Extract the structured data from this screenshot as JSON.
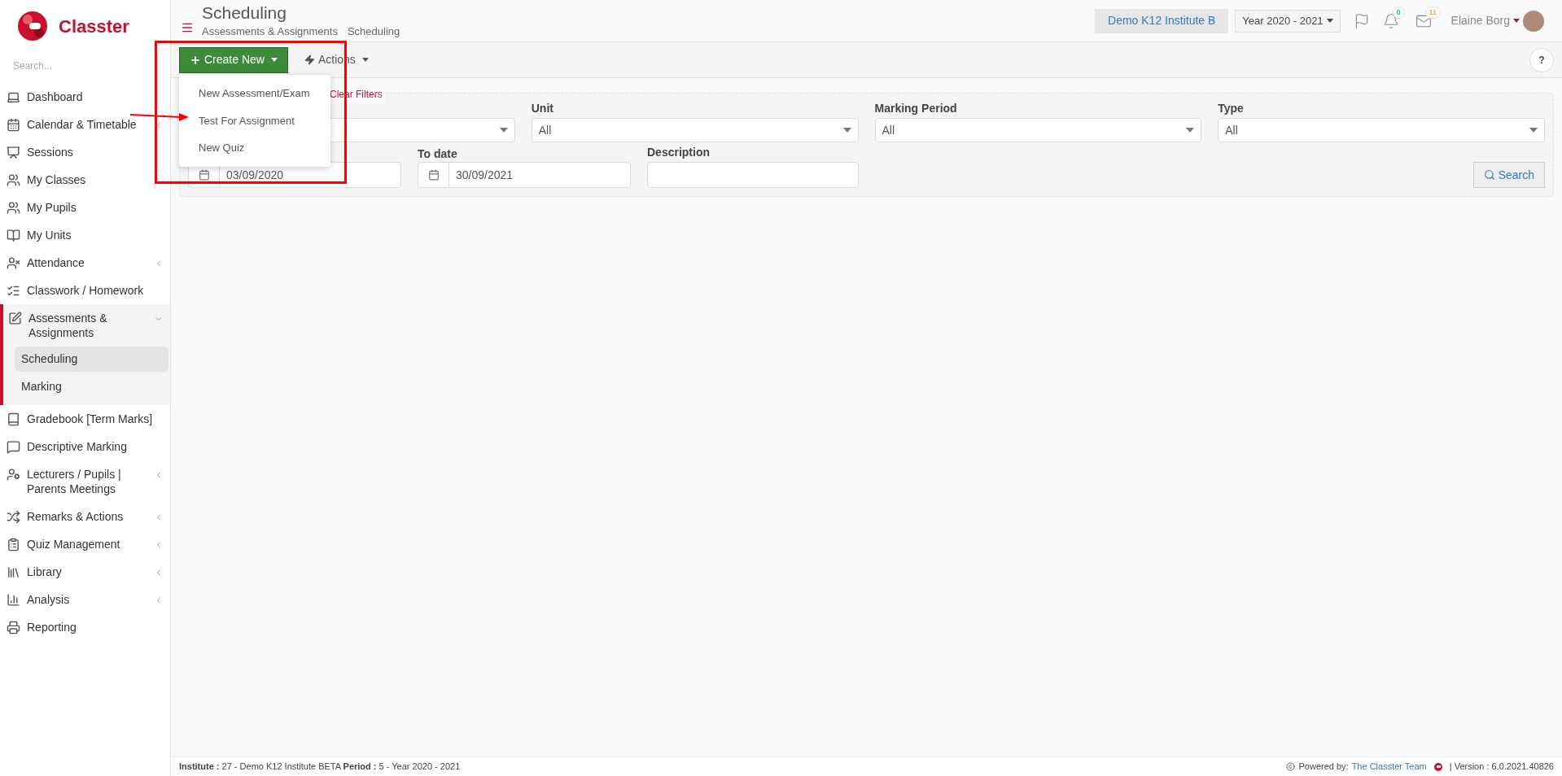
{
  "sidebar": {
    "logo_text": "Classter",
    "search_placeholder": "Search...",
    "items": [
      {
        "label": "Dashboard",
        "expandable": false,
        "selected": false
      },
      {
        "label": "Calendar & Timetable",
        "expandable": true,
        "selected": false
      },
      {
        "label": "Sessions",
        "expandable": false,
        "selected": false
      },
      {
        "label": "My Classes",
        "expandable": false,
        "selected": false
      },
      {
        "label": "My Pupils",
        "expandable": false,
        "selected": false
      },
      {
        "label": "My Units",
        "expandable": false,
        "selected": false
      },
      {
        "label": "Attendance",
        "expandable": true,
        "selected": false
      },
      {
        "label": "Classwork / Homework",
        "expandable": false,
        "selected": false
      },
      {
        "label": "Assessments & Assignments",
        "expandable": true,
        "expanded": true,
        "selected": true,
        "children": [
          {
            "label": "Scheduling",
            "selected": true
          },
          {
            "label": "Marking",
            "selected": false
          }
        ]
      },
      {
        "label": "Gradebook [Term Marks]",
        "expandable": false,
        "selected": false
      },
      {
        "label": "Descriptive Marking",
        "expandable": false,
        "selected": false
      },
      {
        "label": "Lecturers / Pupils | Parents Meetings",
        "expandable": true,
        "selected": false
      },
      {
        "label": "Remarks & Actions",
        "expandable": true,
        "selected": false
      },
      {
        "label": "Quiz Management",
        "expandable": true,
        "selected": false
      },
      {
        "label": "Library",
        "expandable": true,
        "selected": false
      },
      {
        "label": "Analysis",
        "expandable": true,
        "selected": false
      },
      {
        "label": "Reporting",
        "expandable": false,
        "selected": false
      }
    ]
  },
  "header": {
    "title": "Scheduling",
    "breadcrumb": [
      "Assessments & Assignments",
      "Scheduling"
    ],
    "institute": "Demo K12 Institute B",
    "year": "Year 2020 - 2021",
    "notifications_count": "0",
    "messages_count": "11",
    "user_name": "Elaine Borg"
  },
  "toolbar": {
    "create_button": "Create New",
    "actions_button": "Actions",
    "help_button": "?",
    "create_menu": {
      "open": true,
      "items": [
        "New Assessment/Exam",
        "Test For Assignment",
        "New Quiz"
      ]
    }
  },
  "filters": {
    "clear_link": "Clear Filters",
    "selects": [
      {
        "kind": "dropdown"
      },
      {
        "kind": "dropdown",
        "label": "Unit",
        "value": "All"
      },
      {
        "kind": "dropdown",
        "label": "Marking Period",
        "value": "All"
      },
      {
        "kind": "dropdown",
        "label": "Type",
        "value": "All"
      }
    ],
    "from_date": {
      "value": "03/09/2020"
    },
    "to_date": {
      "label": "To date",
      "value": "30/09/2021"
    },
    "description": {
      "label": "Description"
    },
    "search_button": "Search"
  },
  "annotation": {
    "highlight_box": true,
    "arrow": true
  },
  "footer": {
    "institute_label": "Institute :",
    "institute_value": "27 - Demo K12 Institute BETA",
    "period_label": "Period :",
    "period_value": "5 - Year 2020 - 2021",
    "powered_by": "Powered by:",
    "team_link": "The Classter Team",
    "version": "| Version : 6.0.2021.40826"
  }
}
